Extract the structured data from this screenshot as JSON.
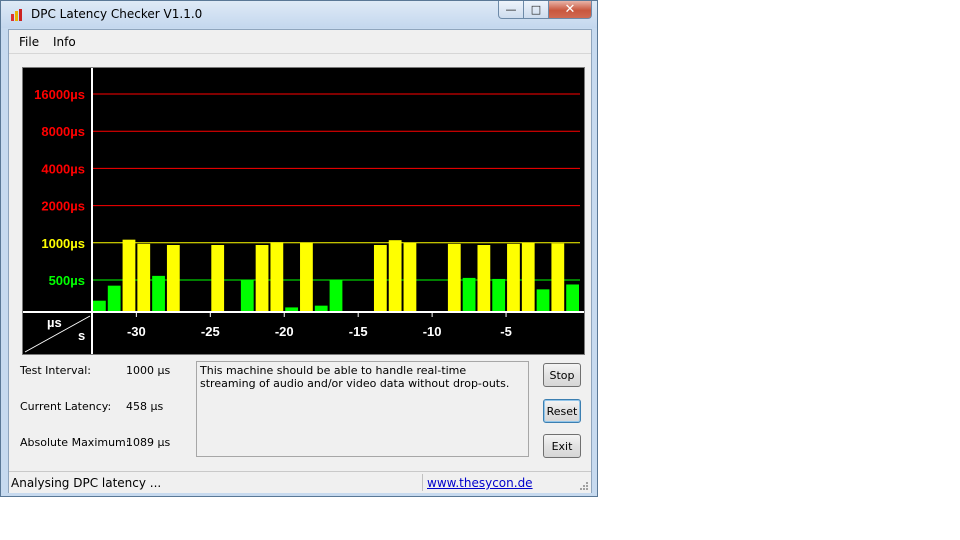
{
  "window": {
    "title": "DPC Latency Checker V1.1.0",
    "controls": {
      "minimize": "—",
      "maximize": "□",
      "close": "✕"
    }
  },
  "menu": {
    "file": "File",
    "info": "Info"
  },
  "chart_data": {
    "type": "bar",
    "y_scale": "log2",
    "thresholds": [
      {
        "label": "16000µs",
        "value": 16000,
        "color": "#ff0000"
      },
      {
        "label": "8000µs",
        "value": 8000,
        "color": "#ff0000"
      },
      {
        "label": "4000µs",
        "value": 4000,
        "color": "#ff0000"
      },
      {
        "label": "2000µs",
        "value": 2000,
        "color": "#ff0000"
      },
      {
        "label": "1000µs",
        "value": 1000,
        "color": "#ffff00"
      },
      {
        "label": "500µs",
        "value": 500,
        "color": "#00ff00"
      }
    ],
    "unit_label_y": "µs",
    "unit_label_x": "s",
    "x_ticks": [
      -30,
      -25,
      -20,
      -15,
      -10,
      -5
    ],
    "x_tick_labels": [
      "-30",
      "-25",
      "-20",
      "-15",
      "-10",
      "-5"
    ],
    "x_range": [
      -33,
      0
    ],
    "colors": {
      "low": "#00ff00",
      "mid": "#ffff00",
      "high": "#ff0000",
      "background": "#000000",
      "axis": "#ffffff"
    },
    "values": [
      340,
      450,
      1060,
      980,
      540,
      960,
      230,
      270,
      960,
      270,
      500,
      960,
      1010,
      300,
      1000,
      310,
      500,
      250,
      250,
      960,
      1050,
      1000,
      280,
      280,
      980,
      520,
      960,
      510,
      980,
      1000,
      420,
      990,
      460
    ]
  },
  "info": {
    "test_interval_label": "Test Interval:",
    "test_interval_value": "1000 µs",
    "current_latency_label": "Current Latency:",
    "current_latency_value": "458 µs",
    "absolute_maximum_label": "Absolute Maximum:",
    "absolute_maximum_value": "1089 µs"
  },
  "message": "This machine should be able to handle real-time streaming of audio and/or video data without drop-outs.",
  "buttons": {
    "stop": "Stop",
    "reset": "Reset",
    "exit": "Exit"
  },
  "status": {
    "text": "Analysing DPC latency ...",
    "link": "www.thesycon.de"
  }
}
